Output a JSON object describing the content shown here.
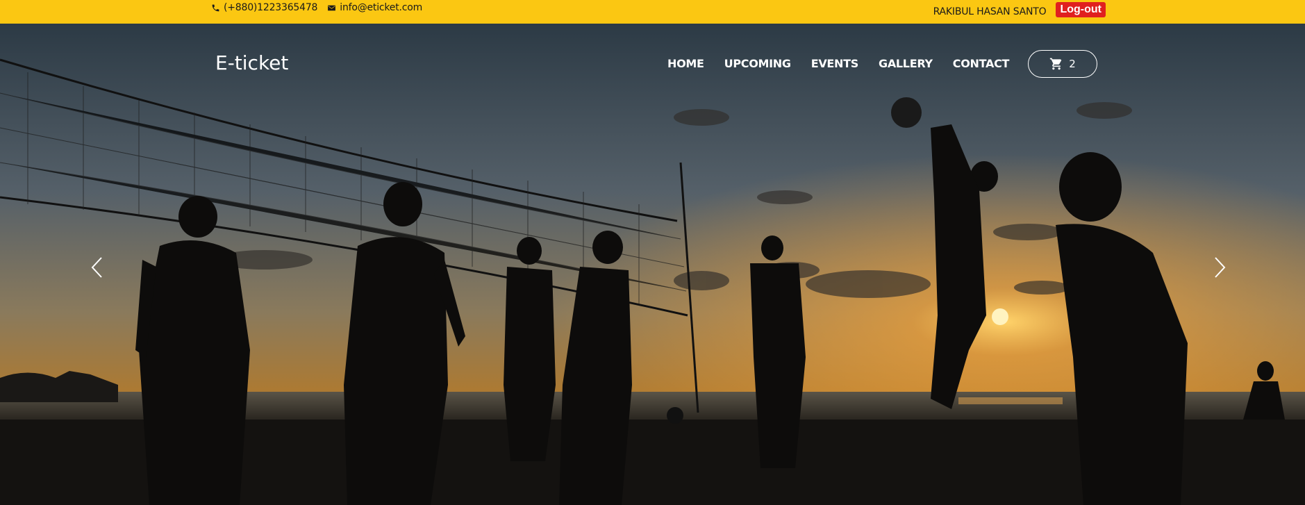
{
  "topbar": {
    "phone": "(+880)1223365478",
    "email": "info@eticket.com",
    "username": "RAKIBUL HASAN SANTO",
    "logout_label": "Log-out"
  },
  "nav": {
    "brand": "E-ticket",
    "items": [
      {
        "label": "HOME"
      },
      {
        "label": "UPCOMING"
      },
      {
        "label": "EVENTS"
      },
      {
        "label": "GALLERY"
      },
      {
        "label": "CONTACT"
      }
    ],
    "cart_count": "2"
  },
  "colors": {
    "topbar_bg": "#fbc712",
    "logout_bg": "#e0201f",
    "nav_text": "#ffffff"
  },
  "icons": {
    "phone": "phone-icon",
    "email": "envelope-icon",
    "cart": "cart-icon",
    "prev": "chevron-left-icon",
    "next": "chevron-right-icon"
  }
}
